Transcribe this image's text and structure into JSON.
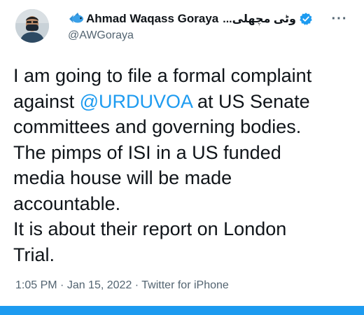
{
  "author": {
    "display_name": "Ahmad Waqass Goraya",
    "urdu_name": "...وٹی مچھلی",
    "handle": "@AWGoraya",
    "verified": true,
    "name_prefix_icon": "fish-icon"
  },
  "menu": {
    "more_label": "···"
  },
  "tweet": {
    "lines": [
      [
        "I am going to file a formal complaint"
      ],
      [
        "against ",
        "@URDUVOA",
        " at US Senate"
      ],
      [
        "committees and governing bodies."
      ],
      [
        "The pimps of ISI in a US funded"
      ],
      [
        "media house will be made"
      ],
      [
        "accountable."
      ],
      [
        "It is about their report on London"
      ],
      [
        "Trial."
      ]
    ],
    "mention": "@URDUVOA"
  },
  "meta": {
    "time": "1:05 PM",
    "separator": " · ",
    "date": "Jan 15, 2022",
    "source": "Twitter for iPhone"
  },
  "colors": {
    "accent": "#1d9bf0",
    "text": "#0f1419",
    "muted": "#536471"
  }
}
